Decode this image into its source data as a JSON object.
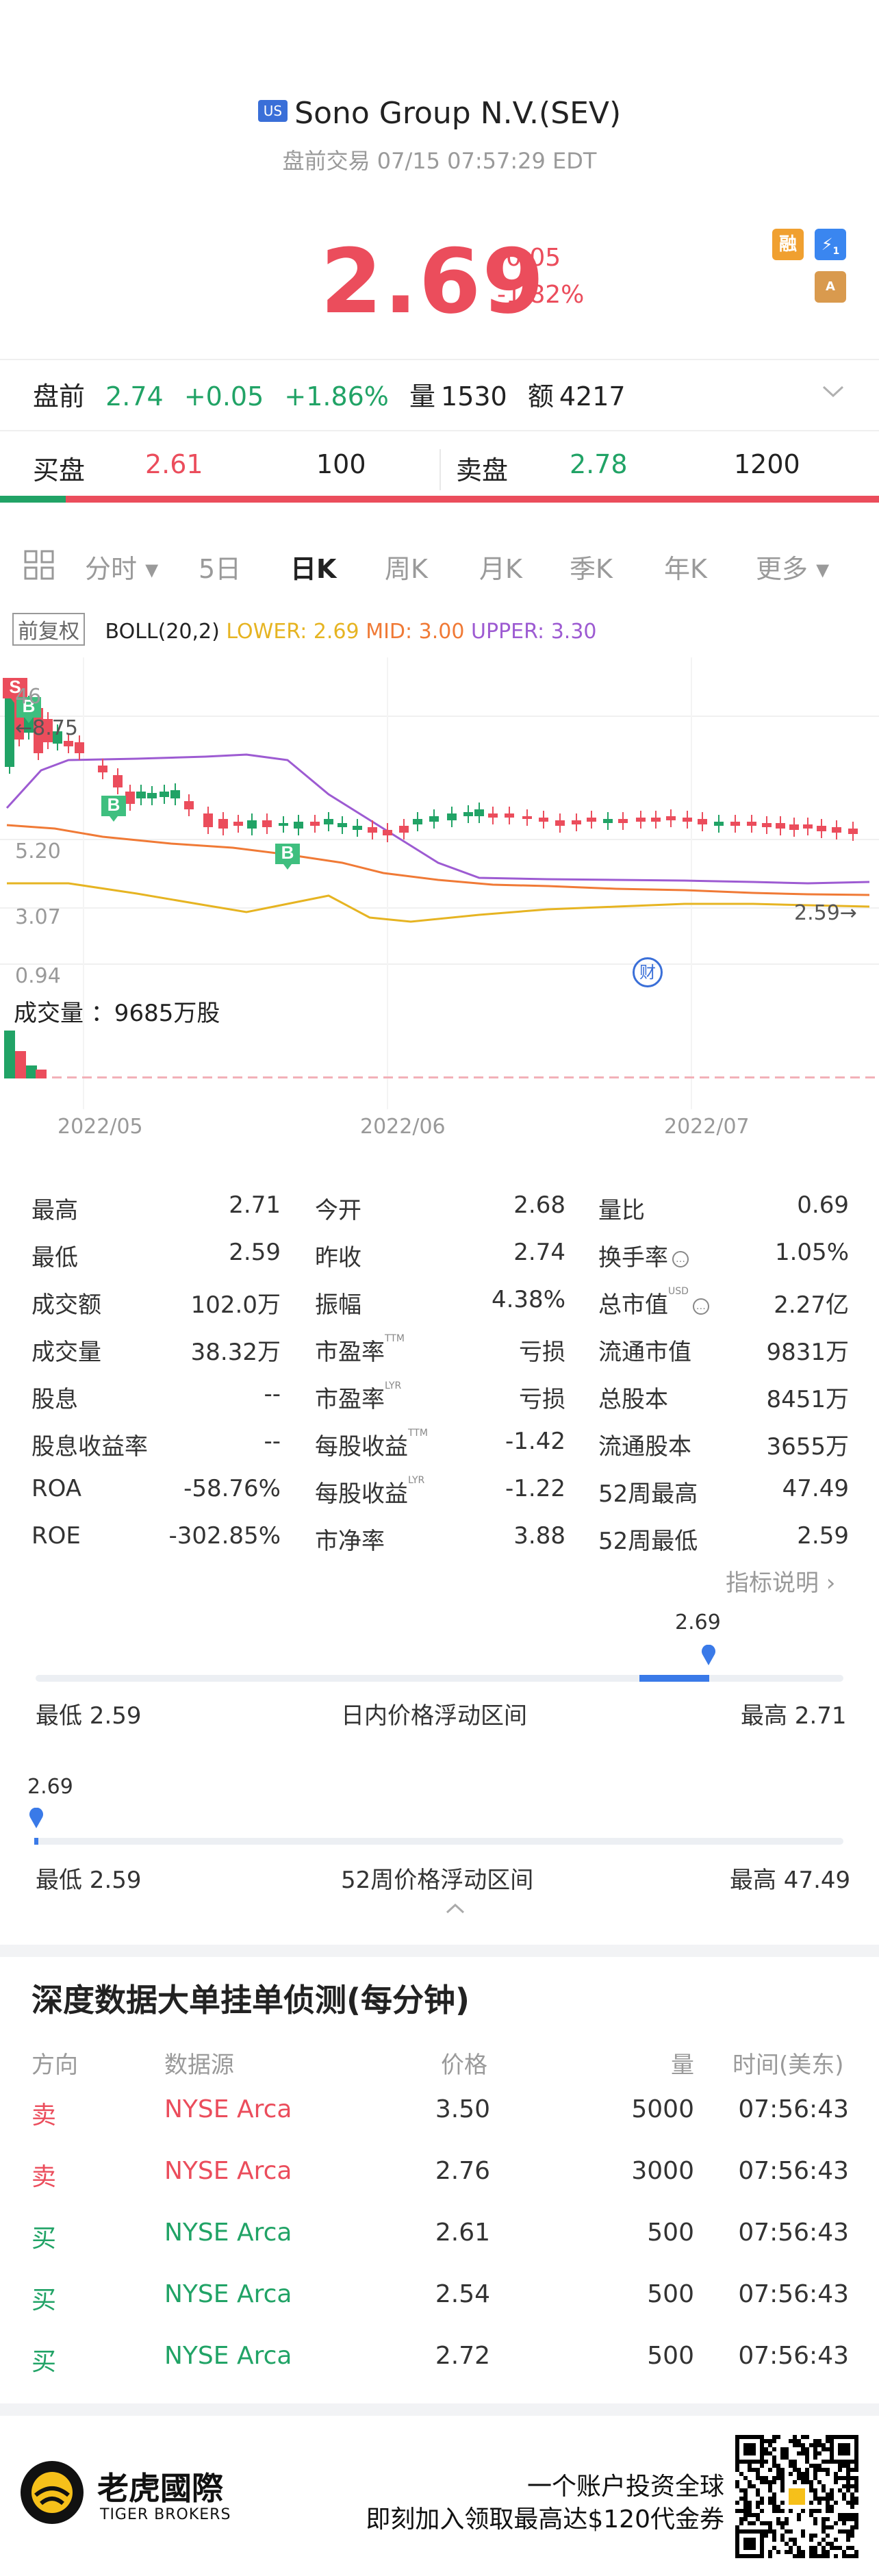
{
  "header": {
    "exchange_badge": "US",
    "title": "Sono Group N.V.(SEV)",
    "session_line": "盘前交易 07/15 07:57:29 EDT",
    "price": "2.69",
    "change": "-0.05",
    "change_pct": "-1.82%",
    "tag_margin": "融",
    "tag_flash": "⚡",
    "tag_flash_sub": "1",
    "tag_a": "A"
  },
  "premarket": {
    "label": "盘前",
    "price": "2.74",
    "change": "+0.05",
    "change_pct": "+1.86%",
    "vol_label": "量",
    "vol": "1530",
    "amt_label": "额",
    "amt": "4217"
  },
  "orderbook": {
    "bid_label": "买盘",
    "bid_price": "2.61",
    "bid_size": "100",
    "ask_label": "卖盘",
    "ask_price": "2.78",
    "ask_size": "1200",
    "bid_share": 0.075
  },
  "tabs": [
    "分时",
    "5日",
    "日K",
    "周K",
    "月K",
    "季K",
    "年K",
    "更多"
  ],
  "active_tab": "日K",
  "indicator": {
    "adjust": "前复权",
    "boll": "BOLL(20,2)",
    "lower": "LOWER: 2.69",
    "mid": "MID: 3.00",
    "upper": "UPPER: 3.30",
    "colors": {
      "lower": "#e6b422",
      "mid": "#f07a36",
      "upper": "#9d5bd2"
    }
  },
  "chart_data": {
    "type": "candlestick",
    "y_ticks": [
      "8.75",
      "5.20",
      "3.07",
      "0.94"
    ],
    "top_partial": "46",
    "last_price_label": "2.59",
    "x_ticks": [
      "2022/05",
      "2022/06",
      "2022/07"
    ],
    "volume_label": "成交量 ：9685万股",
    "buy_marker": "B",
    "sell_marker": "S",
    "finance_marker": "财"
  },
  "stats": [
    [
      {
        "l": "最高",
        "v": "2.71"
      },
      {
        "l": "今开",
        "v": "2.68"
      },
      {
        "l": "量比",
        "v": "0.69"
      }
    ],
    [
      {
        "l": "最低",
        "v": "2.59"
      },
      {
        "l": "昨收",
        "v": "2.74"
      },
      {
        "l": "换手率",
        "v": "1.05%",
        "info": true
      }
    ],
    [
      {
        "l": "成交额",
        "v": "102.0万"
      },
      {
        "l": "振幅",
        "v": "4.38%"
      },
      {
        "l": "总市值",
        "v": "2.27亿",
        "sup": "USD",
        "info": true
      }
    ],
    [
      {
        "l": "成交量",
        "v": "38.32万"
      },
      {
        "l": "市盈率",
        "v": "亏损",
        "sup": "TTM"
      },
      {
        "l": "流通市值",
        "v": "9831万"
      }
    ],
    [
      {
        "l": "股息",
        "v": "--"
      },
      {
        "l": "市盈率",
        "v": "亏损",
        "sup": "LYR"
      },
      {
        "l": "总股本",
        "v": "8451万"
      }
    ],
    [
      {
        "l": "股息收益率",
        "v": "--"
      },
      {
        "l": "每股收益",
        "v": "-1.42",
        "sup": "TTM"
      },
      {
        "l": "流通股本",
        "v": "3655万"
      }
    ],
    [
      {
        "l": "ROA",
        "v": "-58.76%"
      },
      {
        "l": "每股收益",
        "v": "-1.22",
        "sup": "LYR"
      },
      {
        "l": "52周最高",
        "v": "47.49"
      }
    ],
    [
      {
        "l": "ROE",
        "v": "-302.85%"
      },
      {
        "l": "市净率",
        "v": "3.88"
      },
      {
        "l": "52周最低",
        "v": "2.59"
      }
    ]
  ],
  "indicator_help": "指标说明",
  "day_range": {
    "current": "2.69",
    "low_label": "最低 2.59",
    "title": "日内价格浮动区间",
    "high_label": "最高 2.71",
    "position": 0.83
  },
  "week52_range": {
    "current": "2.69",
    "low_label": "最低 2.59",
    "title": "52周价格浮动区间",
    "high_label": "最高 47.49",
    "position": 0.002
  },
  "deep": {
    "title": "深度数据大单挂单侦测(每分钟)",
    "headers": [
      "方向",
      "数据源",
      "价格",
      "量",
      "时间(美东)"
    ],
    "rows": [
      {
        "dir": "卖",
        "src": "NYSE Arca",
        "price": "3.50",
        "qty": "5000",
        "time": "07:56:43"
      },
      {
        "dir": "卖",
        "src": "NYSE Arca",
        "price": "2.76",
        "qty": "3000",
        "time": "07:56:43"
      },
      {
        "dir": "买",
        "src": "NYSE Arca",
        "price": "2.61",
        "qty": "500",
        "time": "07:56:43"
      },
      {
        "dir": "买",
        "src": "NYSE Arca",
        "price": "2.54",
        "qty": "500",
        "time": "07:56:43"
      },
      {
        "dir": "买",
        "src": "NYSE Arca",
        "price": "2.72",
        "qty": "500",
        "time": "07:56:43"
      }
    ]
  },
  "footer": {
    "brand_cn": "老虎國際",
    "brand_en": "TIGER BROKERS",
    "line1": "一个账户投资全球",
    "line2": "即刻加入领取最高达$120代金券"
  }
}
